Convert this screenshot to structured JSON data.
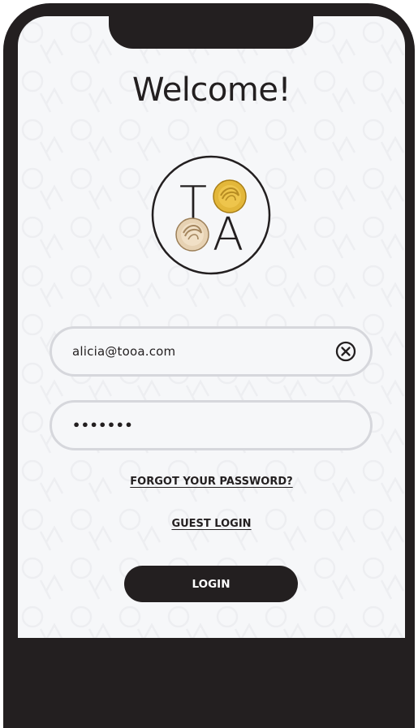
{
  "screen": {
    "title": "Welcome!"
  },
  "logo": {
    "letter_top": "T",
    "letter_bottom": "A",
    "decoration_icon": "macaron-icon"
  },
  "login_form": {
    "email_value": "alicia@tooa.com",
    "clear_icon": "clear-circle-x-icon",
    "password_masked": "•••••••"
  },
  "links": {
    "forgot_password": "FORGOT YOUR PASSWORD?",
    "guest_login": "GUEST LOGIN"
  },
  "actions": {
    "login_label": "LOGIN"
  },
  "colors": {
    "frame": "#231f20",
    "screen_background": "#f6f7f9",
    "field_border": "#d6d7dc",
    "button_background": "#231f20",
    "button_text": "#ffffff",
    "macaron_gold": "#e3b73a",
    "macaron_cream": "#e7d2b3"
  }
}
